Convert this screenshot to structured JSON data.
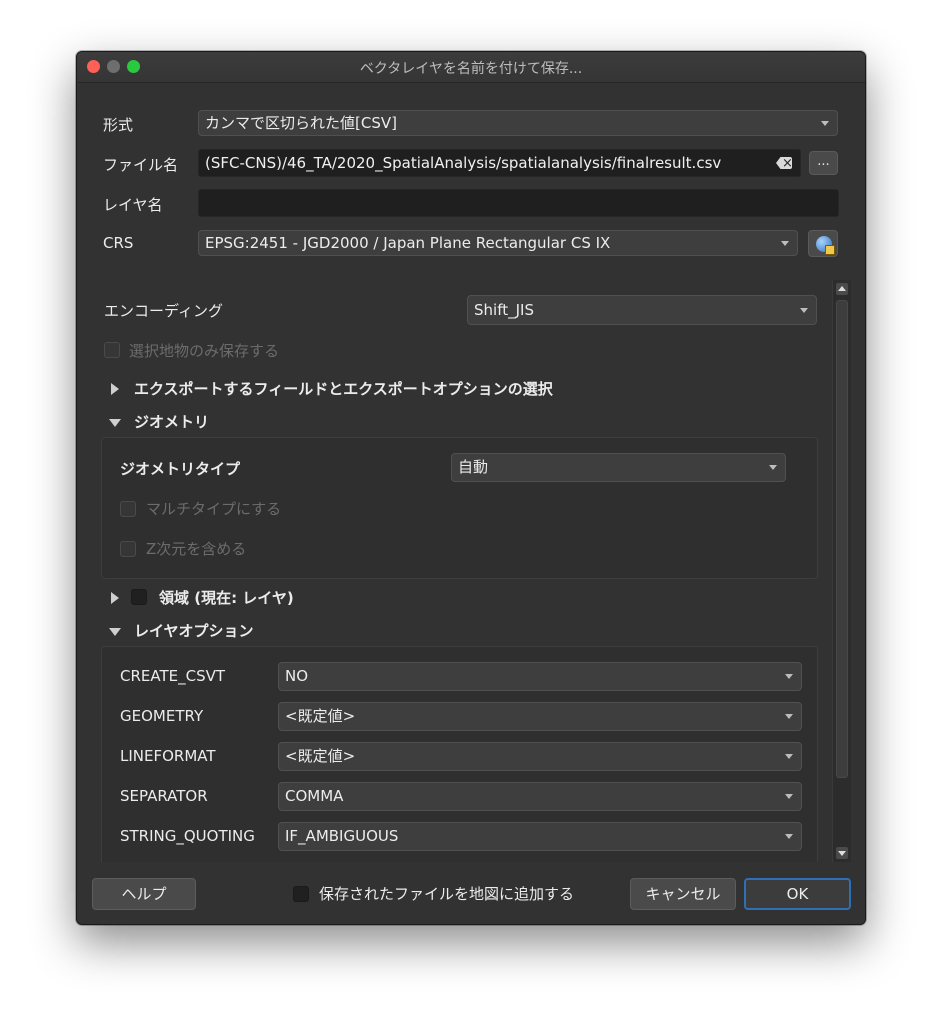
{
  "window": {
    "title": "ベクタレイヤを名前を付けて保存..."
  },
  "form": {
    "format_label": "形式",
    "format_value": "カンマで区切られた値[CSV]",
    "filename_label": "ファイル名",
    "filename_value": "(SFC-CNS)/46_TA/2020_SpatialAnalysis/spatialanalysis/finalresult.csv",
    "browse_label": "...",
    "layername_label": "レイヤ名",
    "layername_value": "",
    "crs_label": "CRS",
    "crs_value": "EPSG:2451 - JGD2000 / Japan Plane Rectangular CS IX"
  },
  "options": {
    "encoding_label": "エンコーディング",
    "encoding_value": "Shift_JIS",
    "selected_only_label": "選択地物のみ保存する",
    "export_fields_label": "エクスポートするフィールドとエクスポートオプションの選択",
    "geometry_section": "ジオメトリ",
    "geometry_type_label": "ジオメトリタイプ",
    "geometry_type_value": "自動",
    "multitype_label": "マルチタイプにする",
    "z_dimension_label": "Z次元を含める",
    "extent_label": "領域 (現在: レイヤ)",
    "layer_options_section": "レイヤオプション",
    "layer_options": [
      {
        "key": "CREATE_CSVT",
        "value": "NO"
      },
      {
        "key": "GEOMETRY",
        "value": "<既定値>"
      },
      {
        "key": "LINEFORMAT",
        "value": "<既定値>"
      },
      {
        "key": "SEPARATOR",
        "value": "COMMA"
      },
      {
        "key": "STRING_QUOTING",
        "value": "IF_AMBIGUOUS"
      }
    ]
  },
  "footer": {
    "help_label": "ヘルプ",
    "add_to_map_label": "保存されたファイルを地図に追加する",
    "cancel_label": "キャンセル",
    "ok_label": "OK"
  }
}
